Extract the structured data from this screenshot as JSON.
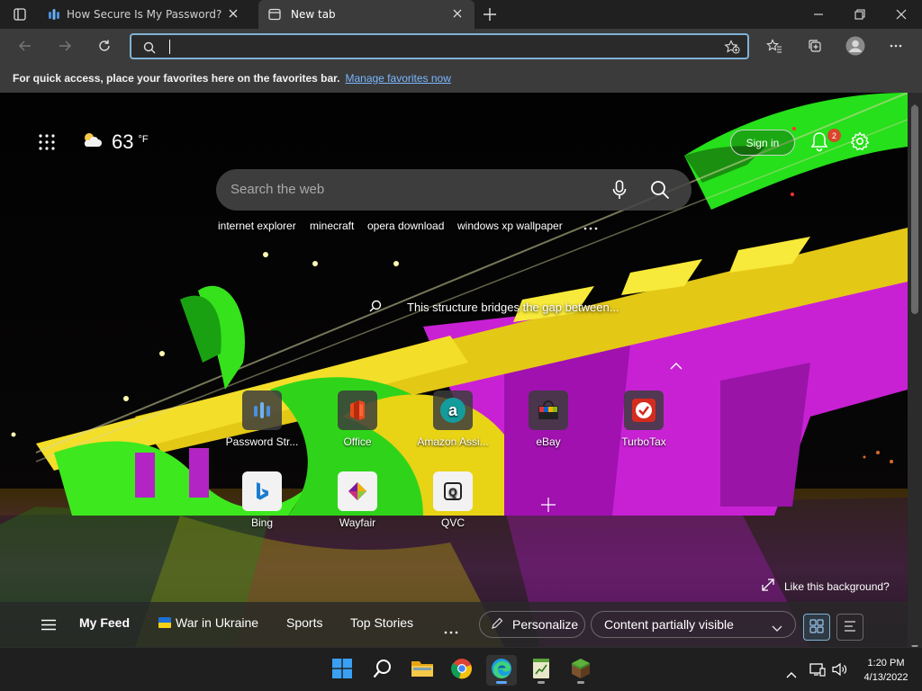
{
  "tabs": [
    {
      "label": "How Secure Is My Password? | Pa",
      "active": false
    },
    {
      "label": "New tab",
      "active": true
    }
  ],
  "address": {
    "value": ""
  },
  "favorites_bar": {
    "message": "For quick access, place your favorites here on the favorites bar.",
    "link": "Manage favorites now"
  },
  "weather": {
    "temp": "63",
    "unit": "°F"
  },
  "header": {
    "sign_in": "Sign in",
    "notifications_count": "2"
  },
  "search": {
    "placeholder": "Search the web",
    "suggestions": [
      "internet explorer",
      "minecraft",
      "opera download",
      "windows xp wallpaper"
    ]
  },
  "caption": "This structure bridges the gap between...",
  "quick_links": [
    {
      "label": "Password Str...",
      "icon": "password-strength-icon"
    },
    {
      "label": "Office",
      "icon": "office-icon"
    },
    {
      "label": "Amazon Assi...",
      "icon": "amazon-icon"
    },
    {
      "label": "eBay",
      "icon": "ebay-icon"
    },
    {
      "label": "TurboTax",
      "icon": "turbotax-icon"
    },
    {
      "label": "Bing",
      "icon": "bing-icon"
    },
    {
      "label": "Wayfair",
      "icon": "wayfair-icon"
    },
    {
      "label": "QVC",
      "icon": "qvc-icon"
    }
  ],
  "like_background": "Like this background?",
  "feed": {
    "items": [
      "My Feed",
      "War in Ukraine",
      "Sports",
      "Top Stories"
    ],
    "personalize": "Personalize",
    "content_visibility": "Content partially visible"
  },
  "taskbar": {
    "time": "1:20 PM",
    "date": "4/13/2022"
  },
  "colors": {
    "accent": "#7fb3d5",
    "link": "#7ab7ff",
    "badge": "#d9452c"
  }
}
